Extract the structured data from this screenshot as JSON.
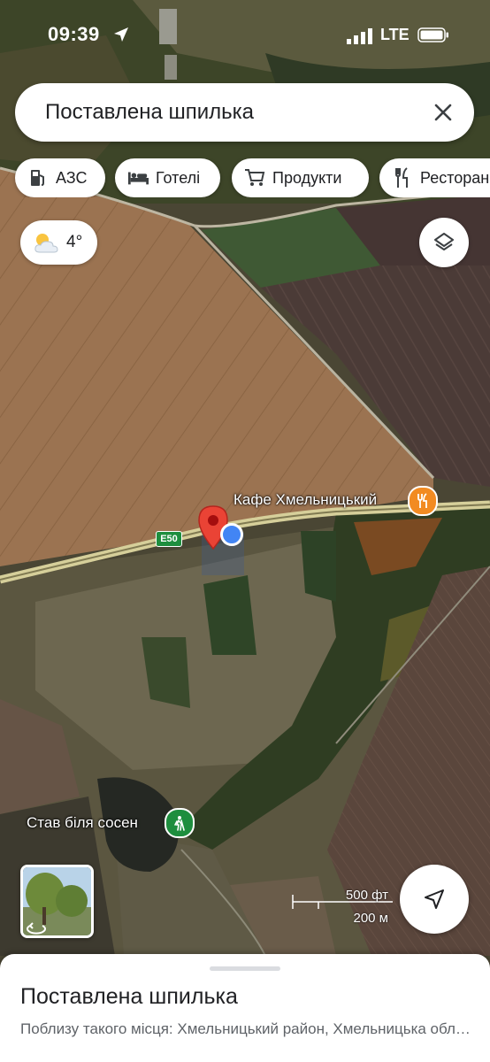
{
  "status_bar": {
    "time": "09:39",
    "network": "LTE"
  },
  "search": {
    "query": "Поставлена шпилька"
  },
  "chips": [
    {
      "label": "АЗС",
      "icon": "gas-station-icon"
    },
    {
      "label": "Готелі",
      "icon": "bed-icon"
    },
    {
      "label": "Продукти",
      "icon": "shopping-cart-icon"
    },
    {
      "label": "Ресторани",
      "icon": "restaurant-icon"
    }
  ],
  "weather": {
    "temp": "4°",
    "icon": "partly-cloudy-icon"
  },
  "map": {
    "poi_cafe": "Кафе Хмельницький",
    "poi_pond": "Став біля сосен",
    "road_label": "E50",
    "scale_ft": "500 фт",
    "scale_m": "200 м"
  },
  "bottom_sheet": {
    "title": "Поставлена шпилька",
    "subtitle": "Поблизу такого місця: Хмельницький район, Хмельницька область"
  }
}
